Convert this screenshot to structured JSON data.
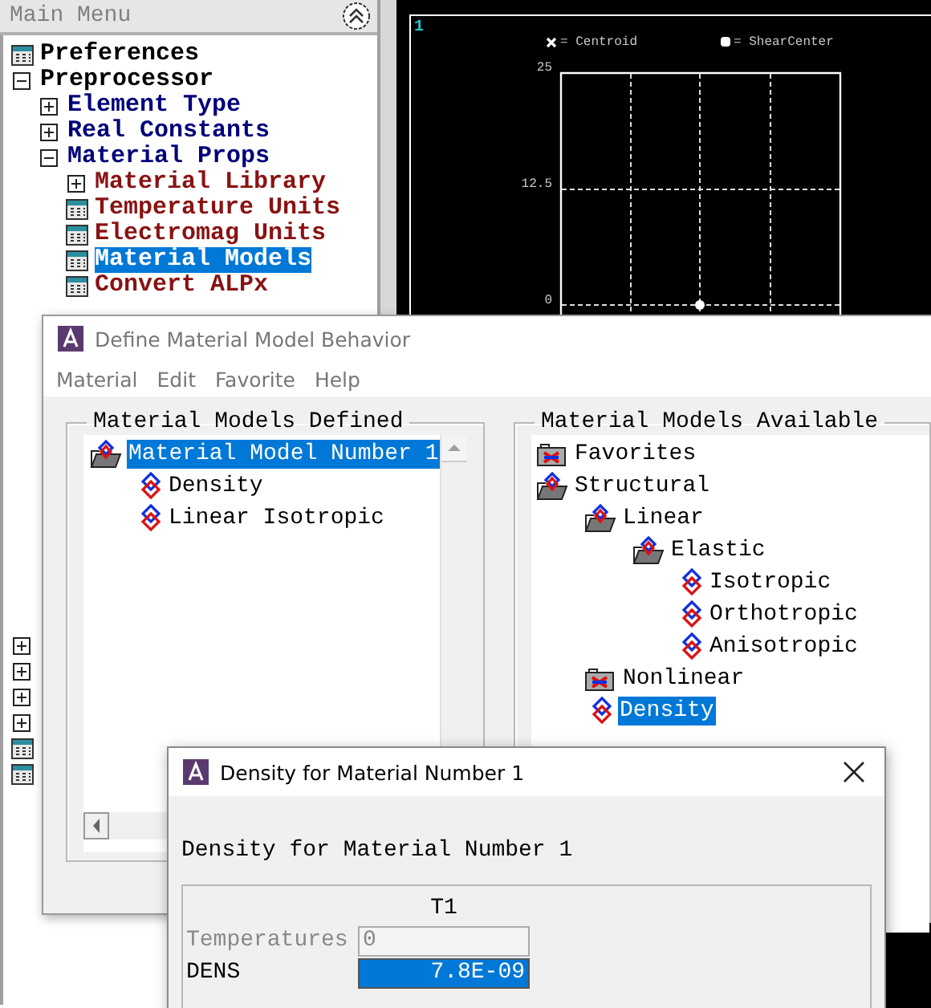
{
  "main_menu": {
    "title": "Main Menu",
    "items": [
      {
        "label": "Preferences",
        "kind": "sheet",
        "selected": false
      },
      {
        "label": "Preprocessor",
        "kind": "minus",
        "selected": false,
        "children": [
          {
            "label": "Element Type",
            "kind": "plus",
            "selected": false
          },
          {
            "label": "Real Constants",
            "kind": "plus",
            "selected": false
          },
          {
            "label": "Material Props",
            "kind": "minus",
            "selected": false,
            "children": [
              {
                "label": "Material Library",
                "kind": "plus",
                "selected": false
              },
              {
                "label": "Temperature Units",
                "kind": "sheet",
                "selected": false
              },
              {
                "label": "Electromag Units",
                "kind": "sheet",
                "selected": false
              },
              {
                "label": "Material Models",
                "kind": "sheet",
                "selected": true
              },
              {
                "label": "Convert ALPx",
                "kind": "sheet",
                "selected": false
              }
            ]
          }
        ]
      },
      {
        "kind": "plus"
      },
      {
        "kind": "plus"
      },
      {
        "kind": "plus"
      },
      {
        "kind": "plus"
      },
      {
        "kind": "sheet"
      },
      {
        "kind": "sheet"
      }
    ]
  },
  "graphics": {
    "viewport": "1",
    "legend": [
      {
        "kind": "centroid",
        "label": "= Centroid"
      },
      {
        "kind": "shear-center",
        "label": "= ShearCenter"
      }
    ],
    "y_labels": [
      "25",
      "12.5",
      "0"
    ]
  },
  "material_dialog": {
    "title": "Define Material Model Behavior",
    "active": false,
    "menu": [
      "Material",
      "Edit",
      "Favorite",
      "Help"
    ],
    "defined": {
      "title": "Material Models Defined",
      "items": [
        {
          "label": "Material Model Number 1",
          "kind": "folder-open",
          "selected": true,
          "children": [
            {
              "label": "Density",
              "kind": "model",
              "selected": false
            },
            {
              "label": "Linear Isotropic",
              "kind": "model",
              "selected": false
            }
          ]
        }
      ]
    },
    "available": {
      "title": "Material Models Available",
      "items": [
        {
          "label": "Favorites",
          "kind": "folder",
          "selected": false
        },
        {
          "label": "Structural",
          "kind": "folder-open",
          "selected": false,
          "children": [
            {
              "label": "Linear",
              "kind": "folder-open",
              "selected": false,
              "children": [
                {
                  "label": "Elastic",
                  "kind": "folder-open",
                  "selected": false,
                  "children": [
                    {
                      "label": "Isotropic",
                      "kind": "model",
                      "selected": false
                    },
                    {
                      "label": "Orthotropic",
                      "kind": "model",
                      "selected": false
                    },
                    {
                      "label": "Anisotropic",
                      "kind": "model",
                      "selected": false
                    }
                  ]
                }
              ]
            },
            {
              "label": "Nonlinear",
              "kind": "folder",
              "selected": false
            },
            {
              "label": "Density",
              "kind": "model",
              "selected": true
            }
          ]
        }
      ]
    }
  },
  "density_dialog": {
    "title": "Density for Material Number 1",
    "heading": "Density for Material Number 1",
    "column": "T1",
    "rows": [
      {
        "label": "Temperatures",
        "value": "0",
        "disabled": true,
        "selected": false
      },
      {
        "label": "DENS",
        "value": "7.8E-09",
        "disabled": false,
        "selected": true
      }
    ]
  }
}
